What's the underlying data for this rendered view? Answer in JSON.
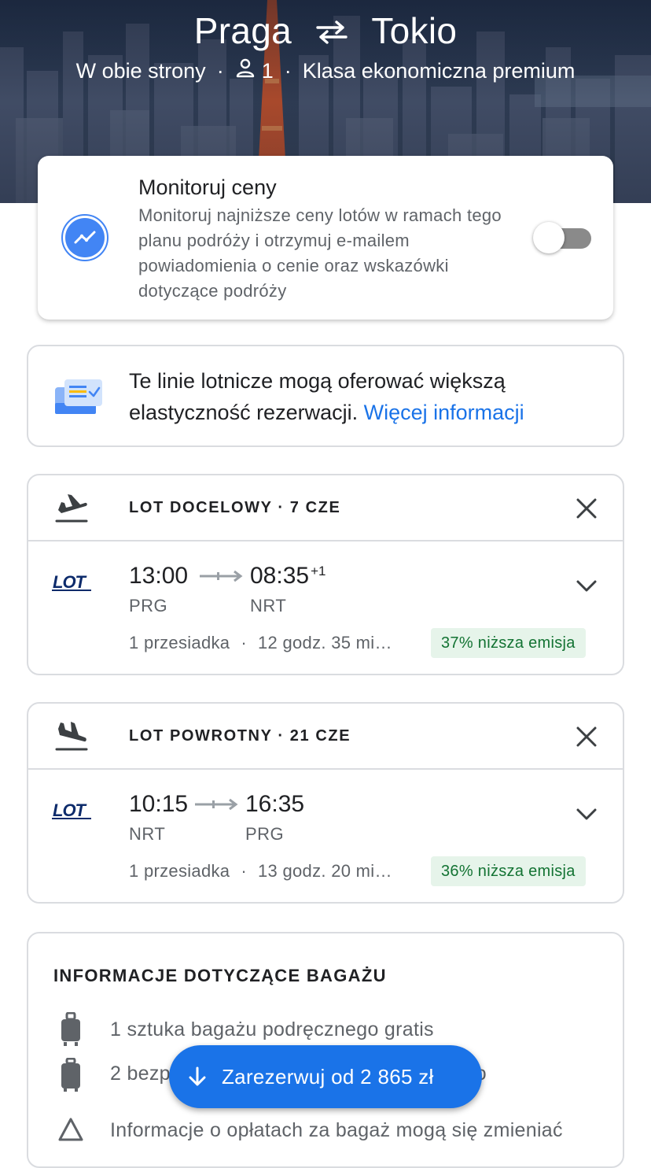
{
  "header": {
    "origin": "Praga",
    "destination": "Tokio",
    "trip_type": "W obie strony",
    "passengers": "1",
    "cabin_class": "Klasa ekonomiczna premium"
  },
  "price_tracking": {
    "title": "Monitoruj ceny",
    "description": "Monitoruj najniższe ceny lotów w ramach tego planu podróży i otrzymuj e-mailem powiadomienia o cenie oraz wskazówki dotyczące podróży",
    "enabled": false
  },
  "flexibility": {
    "text": "Te linie lotnicze mogą oferować większą elastyczność rezerwacji.",
    "link": "Więcej informacji"
  },
  "outbound": {
    "label": "LOT DOCELOWY · 7 CZE",
    "airline": "LOT",
    "departure_time": "13:00",
    "arrival_time": "08:35",
    "day_offset": "+1",
    "from_code": "PRG",
    "to_code": "NRT",
    "stops": "1 przesiadka",
    "duration": "12 godz. 35 mi…",
    "emission": "37% niższa emisja"
  },
  "return": {
    "label": "LOT POWROTNY · 21 CZE",
    "airline": "LOT",
    "departure_time": "10:15",
    "arrival_time": "16:35",
    "from_code": "NRT",
    "to_code": "PRG",
    "stops": "1 przesiadka",
    "duration": "13 godz. 20 mi…",
    "emission": "36% niższa emisja"
  },
  "baggage": {
    "title": "INFORMACJE DOTYCZĄCE BAGAŻU",
    "items": [
      "1 sztuka bagażu podręcznego gratis",
      "2 bezpłatne sztuki bagażu rejestrowanego",
      "Informacje o opłatach za bagaż mogą się zmieniać"
    ]
  },
  "cta": {
    "label": "Zarezerwuj od 2 865 zł"
  },
  "colors": {
    "accent": "#1a73e8",
    "emission_bg": "#e6f4ea",
    "emission_text": "#137333",
    "toggle_off": "#8a8a8a"
  },
  "icons": [
    "swap-arrows-icon",
    "person-icon",
    "price-trend-icon",
    "booking-flex-icon",
    "takeoff-icon",
    "landing-icon",
    "close-icon",
    "chevron-down-icon",
    "lot-logo",
    "carry-on-bag-icon",
    "checked-bag-icon",
    "warning-icon",
    "arrow-down-icon"
  ]
}
